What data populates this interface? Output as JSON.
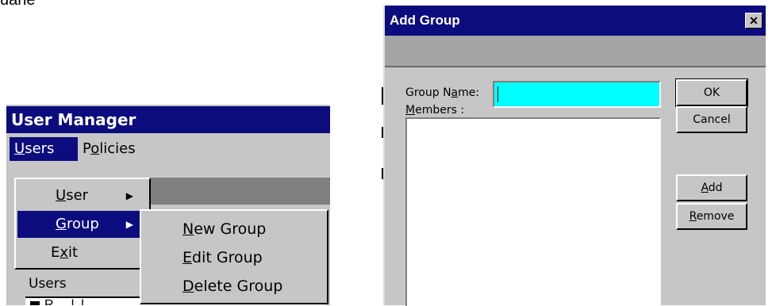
{
  "fragment_top": "uane",
  "user_manager": {
    "title": "User Manager",
    "menubar": {
      "users": {
        "label": "Users",
        "underline": "U",
        "rest": "sers"
      },
      "policies": {
        "label": "Policies",
        "underline": "o",
        "pre": "P",
        "rest": "licies"
      }
    },
    "users_menu": [
      {
        "label": "User",
        "underline": "U",
        "rest": "ser",
        "has_submenu": true
      },
      {
        "label": "Group",
        "underline": "G",
        "rest": "roup",
        "has_submenu": true,
        "selected": true
      },
      {
        "label": "Exit",
        "pre": "E",
        "underline": "x",
        "rest": "it"
      }
    ],
    "group_submenu": [
      {
        "label": "New Group",
        "underline": "N",
        "rest": "ew Group"
      },
      {
        "label": "Edit Group",
        "underline": "E",
        "rest": "dit Group"
      },
      {
        "label": "Delete Group",
        "underline": "D",
        "rest": "elete Group"
      }
    ],
    "users_section_label": "Users",
    "list_row_text": "R... .l .l"
  },
  "add_group": {
    "title": "Add Group",
    "close_glyph": "✕",
    "group_name_label": {
      "pre": "Group N",
      "underline": "a",
      "rest": "me:"
    },
    "group_name_value": "",
    "members_label": {
      "underline": "M",
      "rest": "embers :"
    },
    "buttons": {
      "ok": "OK",
      "cancel": "Cancel",
      "add": {
        "underline": "A",
        "rest": "dd"
      },
      "remove": {
        "underline": "R",
        "rest": "emove"
      }
    }
  },
  "colors": {
    "titlebar": "#0c0c7e",
    "window_face": "#c6c6c6",
    "highlight": "#0c0c7e",
    "input_focus": "#00ffff"
  }
}
